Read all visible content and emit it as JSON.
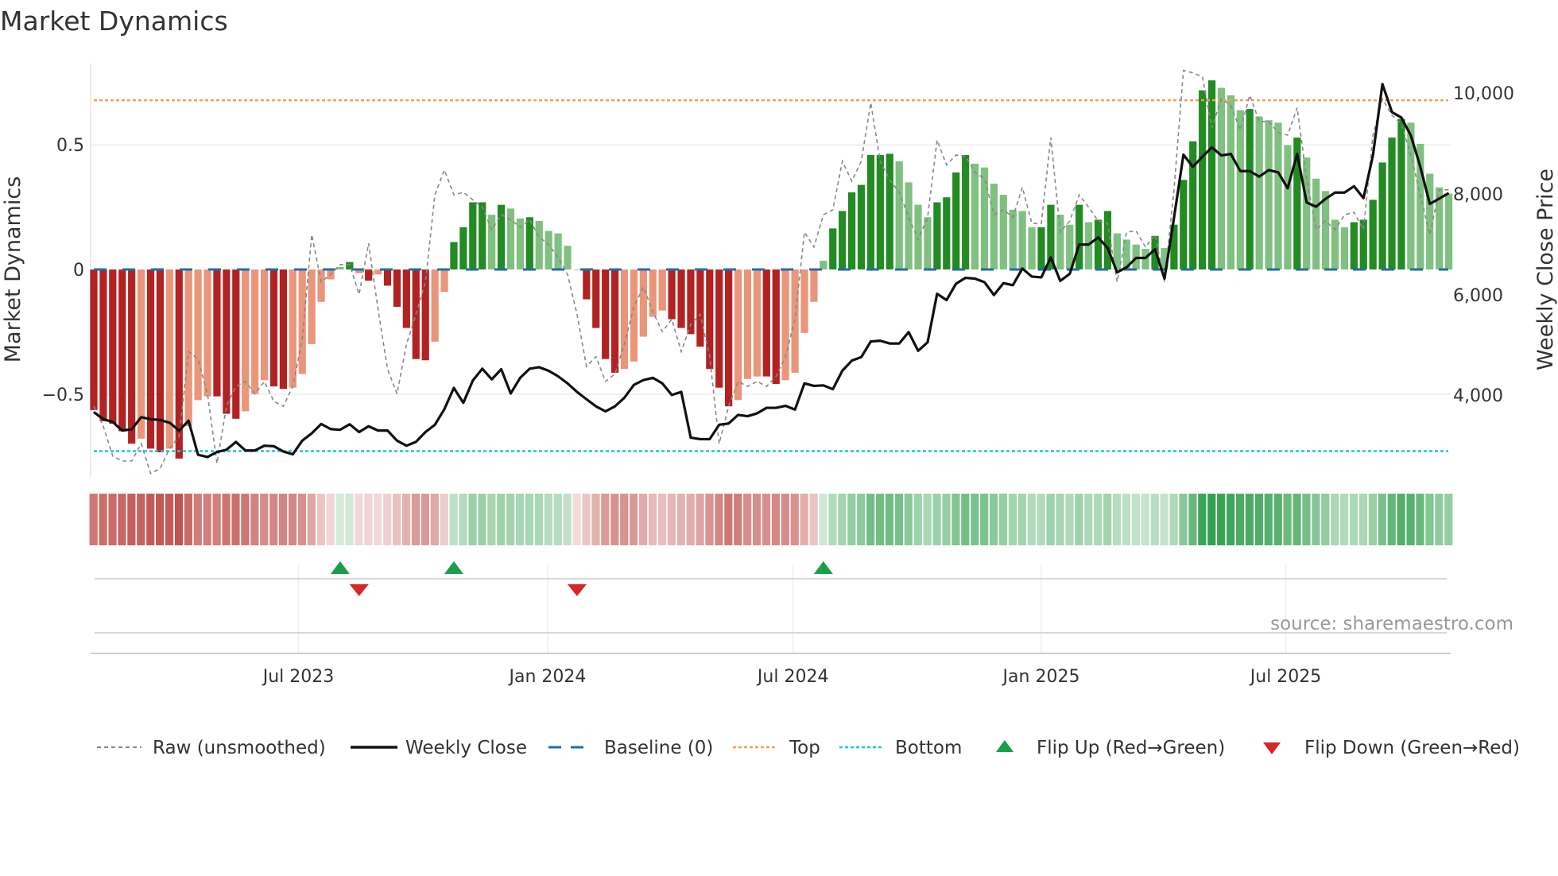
{
  "title": "Market Dynamics",
  "source": "source: sharemaestro.com",
  "chart_data": {
    "type": "bar",
    "title": "Market Dynamics",
    "ylabel_left": "Market Dynamics",
    "ylabel_right": "Weekly Close Price",
    "ylim_left": [
      -0.85,
      0.82
    ],
    "y_left_ticks": [
      {
        "value": 0.5,
        "label": "0.5"
      },
      {
        "value": 0,
        "label": "0"
      },
      {
        "value": -0.5,
        "label": "−0.5"
      }
    ],
    "y_right_ticks": [
      {
        "value": 10000,
        "label": "10,000"
      },
      {
        "value": 8000,
        "label": "8,000"
      },
      {
        "value": 6000,
        "label": "6,000"
      },
      {
        "value": 4000,
        "label": "4,000"
      }
    ],
    "x_ticks": [
      {
        "week": 21.6,
        "label": "Jul 2023"
      },
      {
        "week": 47.9,
        "label": "Jan 2024"
      },
      {
        "week": 73.8,
        "label": "Jul 2024"
      },
      {
        "week": 100.0,
        "label": "Jan 2025"
      },
      {
        "week": 125.8,
        "label": "Jul 2025"
      }
    ],
    "top": 0.68,
    "bottom": -0.73,
    "baseline": 0,
    "smoothed": [
      -0.565,
      -0.61,
      -0.62,
      -0.65,
      -0.7,
      -0.68,
      -0.72,
      -0.735,
      -0.72,
      -0.76,
      -0.63,
      -0.525,
      -0.51,
      -0.51,
      -0.58,
      -0.6,
      -0.57,
      -0.5,
      -0.445,
      -0.47,
      -0.48,
      -0.475,
      -0.42,
      -0.3,
      -0.13,
      -0.04,
      0.01,
      0.03,
      -0.015,
      -0.045,
      -0.02,
      -0.065,
      -0.15,
      -0.235,
      -0.36,
      -0.365,
      -0.29,
      -0.09,
      0.11,
      0.17,
      0.27,
      0.27,
      0.22,
      0.26,
      0.245,
      0.205,
      0.21,
      0.195,
      0.155,
      0.145,
      0.095,
      -0.002,
      -0.12,
      -0.235,
      -0.36,
      -0.415,
      -0.4,
      -0.37,
      -0.27,
      -0.19,
      -0.165,
      -0.2,
      -0.235,
      -0.26,
      -0.31,
      -0.4,
      -0.475,
      -0.55,
      -0.525,
      -0.44,
      -0.43,
      -0.43,
      -0.46,
      -0.445,
      -0.415,
      -0.255,
      -0.13,
      0.035,
      0.165,
      0.235,
      0.31,
      0.34,
      0.46,
      0.46,
      0.465,
      0.435,
      0.35,
      0.26,
      0.21,
      0.27,
      0.29,
      0.39,
      0.46,
      0.425,
      0.41,
      0.345,
      0.3,
      0.24,
      0.235,
      0.17,
      0.17,
      0.26,
      0.22,
      0.18,
      0.26,
      0.19,
      0.2,
      0.235,
      0.145,
      0.12,
      0.1,
      0.083,
      0.135,
      0.086,
      0.18,
      0.36,
      0.515,
      0.72,
      0.76,
      0.73,
      0.7,
      0.64,
      0.645,
      0.615,
      0.6,
      0.59,
      0.5,
      0.53,
      0.45,
      0.365,
      0.315,
      0.2,
      0.17,
      0.19,
      0.2,
      0.28,
      0.43,
      0.53,
      0.605,
      0.59,
      0.505,
      0.385,
      0.33,
      0.305
    ],
    "raw": [
      -0.55,
      -0.63,
      -0.75,
      -0.77,
      -0.77,
      -0.7,
      -0.82,
      -0.8,
      -0.72,
      -0.67,
      -0.33,
      -0.36,
      -0.5,
      -0.78,
      -0.55,
      -0.47,
      -0.45,
      -0.5,
      -0.45,
      -0.53,
      -0.55,
      -0.47,
      -0.28,
      0.14,
      -0.05,
      -0.02,
      0.02,
      0.02,
      -0.1,
      0.105,
      -0.16,
      -0.4,
      -0.5,
      -0.3,
      -0.18,
      -0.05,
      0.3,
      0.4,
      0.3,
      0.31,
      0.28,
      0.25,
      0.16,
      0.22,
      0.2,
      0.17,
      0.2,
      0.13,
      0.1,
      0.05,
      -0.02,
      -0.18,
      -0.39,
      -0.35,
      -0.45,
      -0.42,
      -0.3,
      -0.15,
      -0.07,
      -0.17,
      -0.25,
      -0.2,
      -0.33,
      -0.22,
      -0.18,
      -0.35,
      -0.7,
      -0.55,
      -0.45,
      -0.47,
      -0.45,
      -0.47,
      -0.43,
      -0.35,
      -0.2,
      0.15,
      0.09,
      0.22,
      0.24,
      0.435,
      0.355,
      0.435,
      0.67,
      0.435,
      0.36,
      0.31,
      0.21,
      0.12,
      0.21,
      0.52,
      0.42,
      0.46,
      0.455,
      0.39,
      0.365,
      0.22,
      0.24,
      0.21,
      0.33,
      0.185,
      0.185,
      0.53,
      0.15,
      0.195,
      0.3,
      0.25,
      0.195,
      0.185,
      -0.05,
      0.15,
      0.155,
      0.09,
      0.14,
      -0.05,
      0.32,
      0.8,
      0.79,
      0.775,
      0.57,
      0.685,
      0.66,
      0.56,
      0.7,
      0.595,
      0.595,
      0.55,
      0.54,
      0.65,
      0.365,
      0.16,
      0.195,
      0.16,
      0.22,
      0.23,
      0.16,
      0.54,
      0.685,
      0.62,
      0.585,
      0.46,
      0.3,
      0.14,
      0.32,
      0.32
    ],
    "weekly_close": [
      3670,
      3530,
      3475,
      3305,
      3330,
      3570,
      3530,
      3515,
      3460,
      3305,
      3500,
      2825,
      2780,
      2880,
      2925,
      3080,
      2910,
      2910,
      3005,
      2995,
      2890,
      2835,
      3105,
      3250,
      3435,
      3335,
      3320,
      3430,
      3275,
      3390,
      3305,
      3305,
      3105,
      3005,
      3080,
      3275,
      3420,
      3730,
      4150,
      3855,
      4295,
      4530,
      4320,
      4520,
      4040,
      4350,
      4530,
      4560,
      4490,
      4380,
      4240,
      4070,
      3925,
      3785,
      3685,
      3785,
      3955,
      4210,
      4305,
      4350,
      4240,
      4010,
      4070,
      3165,
      3135,
      3135,
      3420,
      3445,
      3615,
      3590,
      3645,
      3755,
      3755,
      3795,
      3720,
      4240,
      4190,
      4200,
      4125,
      4490,
      4690,
      4760,
      5070,
      5085,
      5030,
      5030,
      5255,
      4885,
      5055,
      6015,
      5890,
      6215,
      6330,
      6315,
      6245,
      5990,
      6225,
      6185,
      6515,
      6355,
      6340,
      6735,
      6270,
      6410,
      6990,
      6990,
      7130,
      6920,
      6440,
      6540,
      6725,
      6725,
      6895,
      6315,
      7515,
      8770,
      8530,
      8730,
      8915,
      8755,
      8785,
      8445,
      8445,
      8335,
      8465,
      8420,
      8105,
      8785,
      7825,
      7740,
      7895,
      8020,
      8020,
      8145,
      7910,
      8755,
      10170,
      9615,
      9505,
      9150,
      8530,
      7795,
      7900,
      8010
    ],
    "flip_up_weeks": [
      26,
      38,
      77
    ],
    "flip_down_weeks": [
      28,
      51
    ],
    "colors": {
      "strong_negative": "#b22222",
      "weak_negative": "#e9967a",
      "strong_positive": "#228b22",
      "weak_positive": "#80c080",
      "close": "#111111",
      "raw": "#888888",
      "baseline": "#1f6fa8",
      "top": "#f0a050",
      "bottom": "#22c4d8",
      "flip_up": "#1a9e4a",
      "flip_down": "#d62728"
    },
    "legend": {
      "placement": "bottom",
      "items": [
        "Raw (unsmoothed)",
        "Weekly Close",
        "Baseline (0)",
        "Top",
        "Bottom",
        "Flip Up (Red→Green)",
        "Flip Down (Green→Red)"
      ]
    }
  }
}
